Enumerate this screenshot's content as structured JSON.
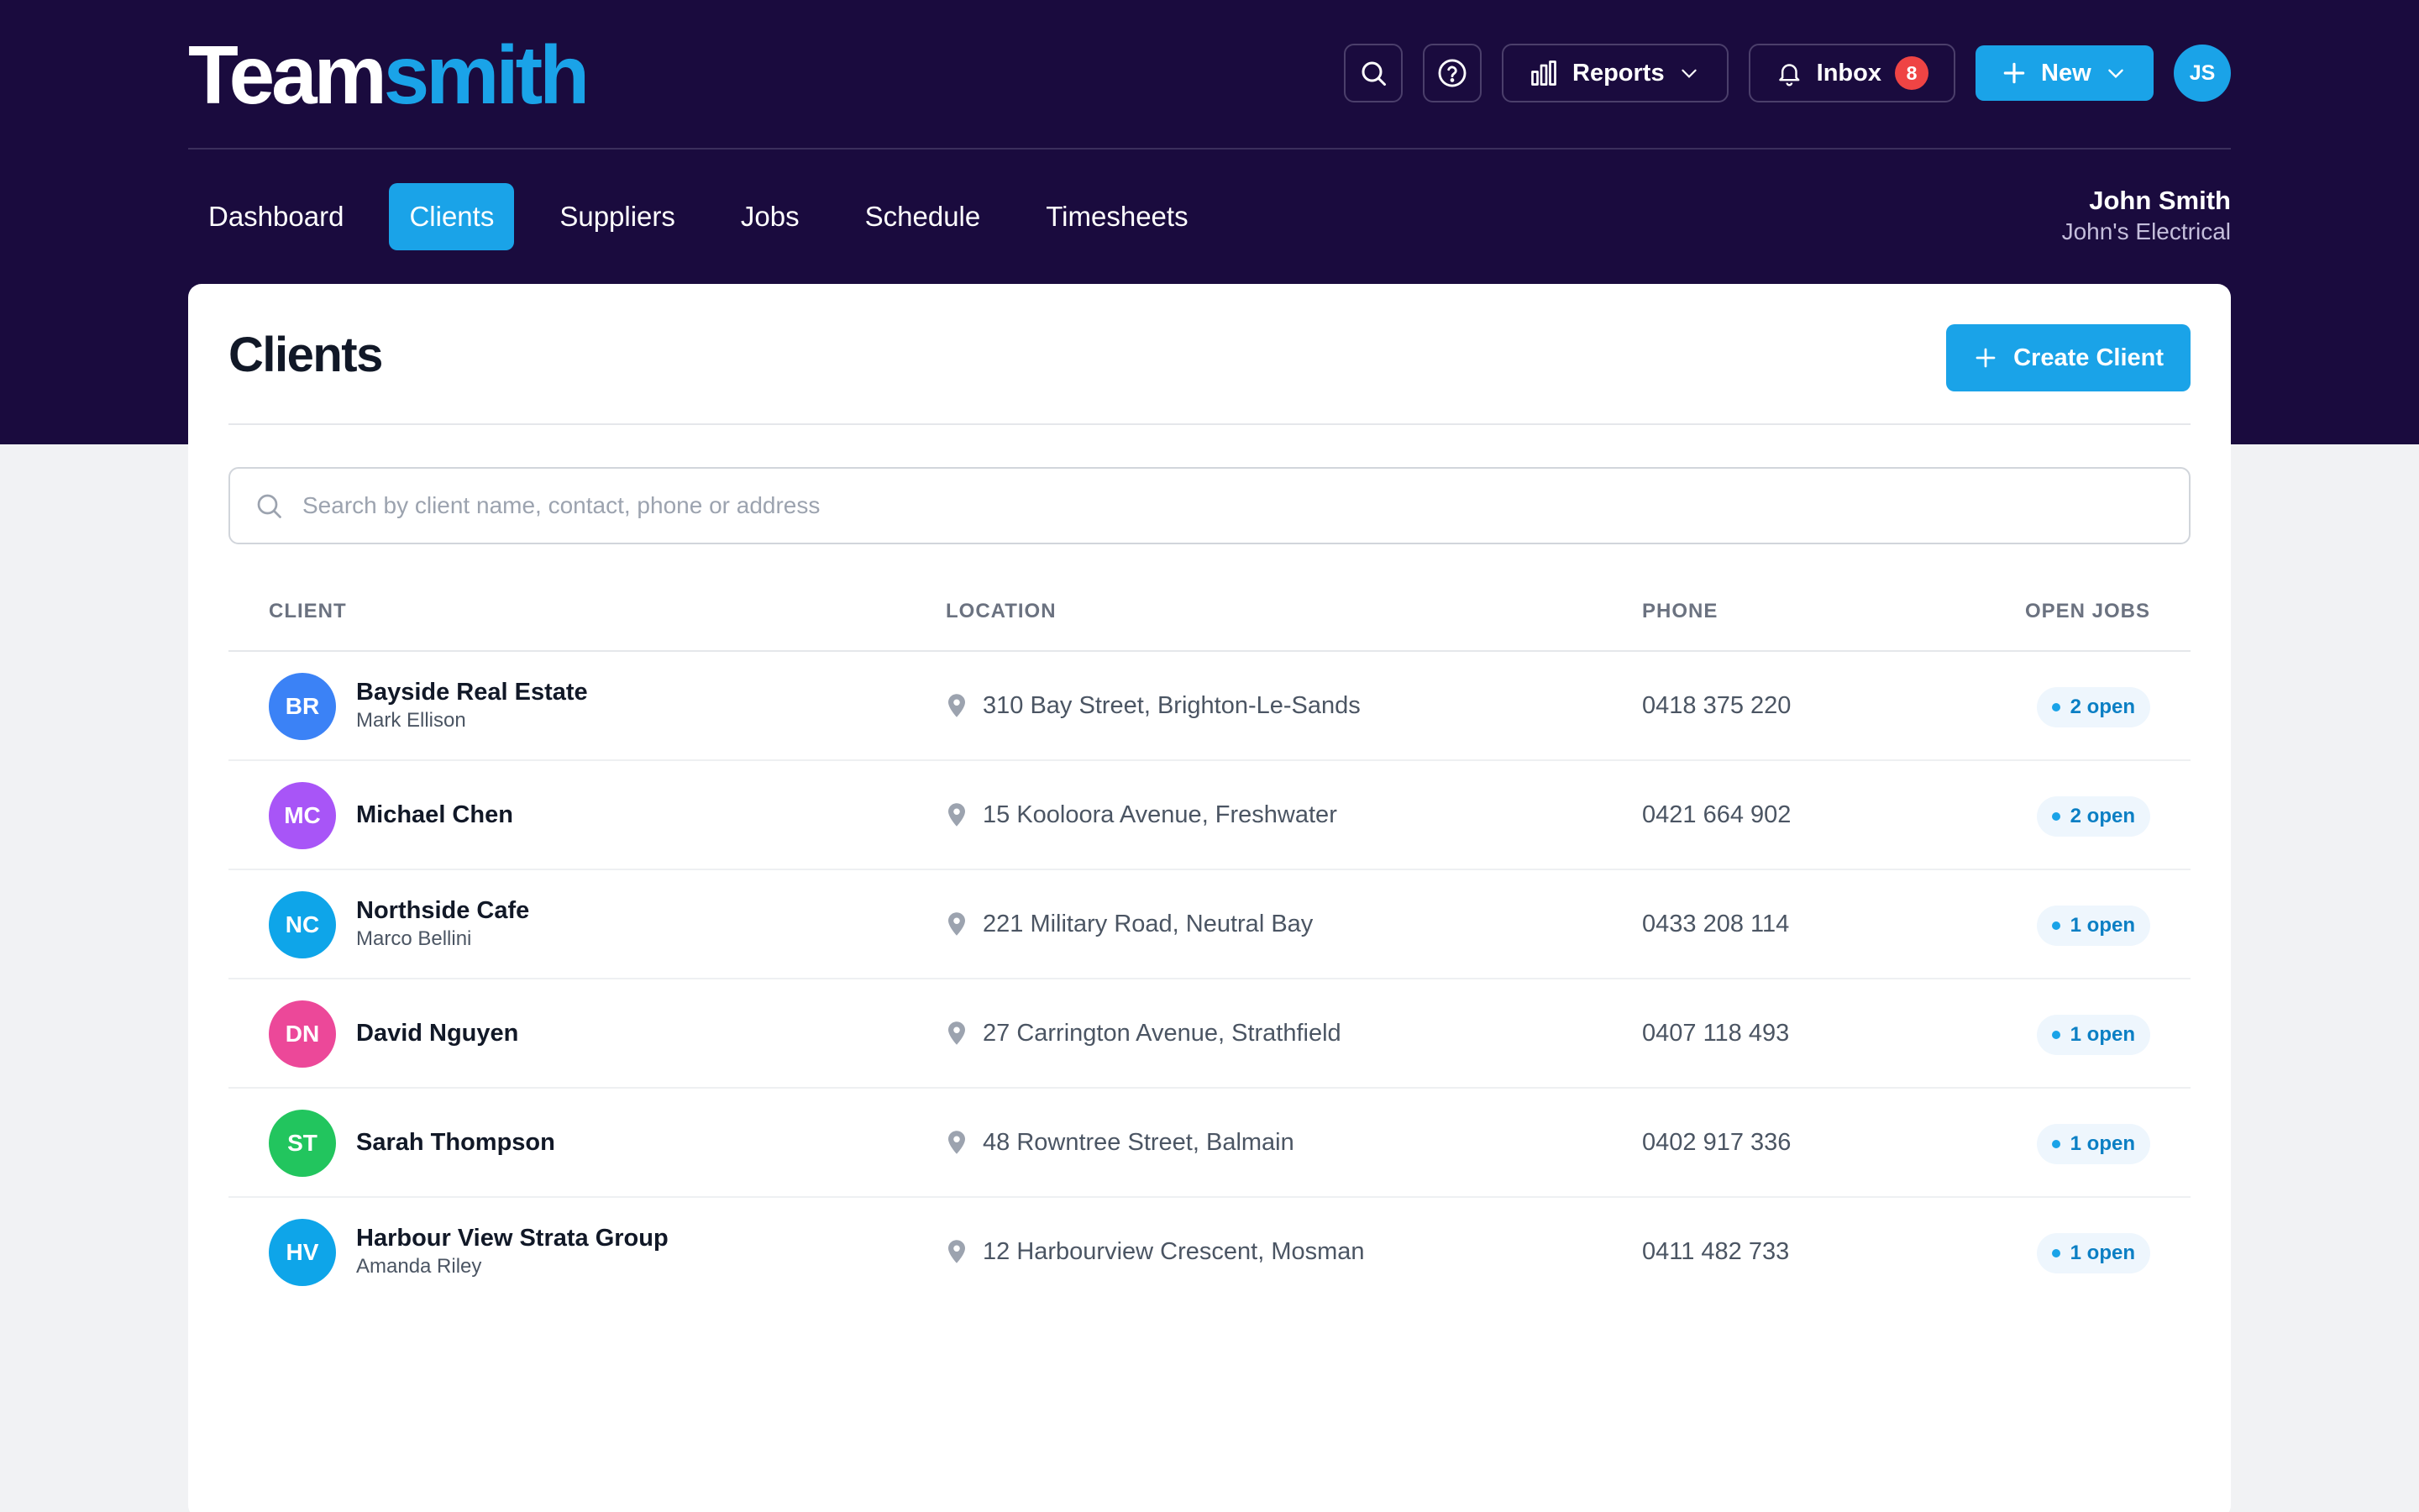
{
  "app": {
    "logo_primary": "Team",
    "logo_accent": "smith"
  },
  "header": {
    "search_icon": "search-icon",
    "help_icon": "help-icon",
    "reports_label": "Reports",
    "inbox_label": "Inbox",
    "inbox_count": "8",
    "new_label": "New",
    "user_initials": "JS"
  },
  "nav": {
    "items": [
      {
        "label": "Dashboard"
      },
      {
        "label": "Clients",
        "active": true
      },
      {
        "label": "Suppliers"
      },
      {
        "label": "Jobs"
      },
      {
        "label": "Schedule"
      },
      {
        "label": "Timesheets"
      }
    ]
  },
  "user": {
    "name": "John Smith",
    "company": "John's Electrical"
  },
  "page": {
    "title": "Clients",
    "create_label": "Create Client",
    "search_placeholder": "Search by client name, contact, phone or address"
  },
  "table": {
    "headers": {
      "client": "CLIENT",
      "location": "LOCATION",
      "phone": "PHONE",
      "open_jobs": "OPEN JOBS"
    },
    "rows": [
      {
        "initials": "BR",
        "color": "#3b82f6",
        "name": "Bayside Real Estate",
        "contact": "Mark Ellison",
        "location": "310 Bay Street, Brighton-Le-Sands",
        "phone": "0418 375 220",
        "open_jobs": "2 open"
      },
      {
        "initials": "MC",
        "color": "#a855f7",
        "name": "Michael Chen",
        "contact": "",
        "location": "15 Kooloora Avenue, Freshwater",
        "phone": "0421 664 902",
        "open_jobs": "2 open"
      },
      {
        "initials": "NC",
        "color": "#0ea5e9",
        "name": "Northside Cafe",
        "contact": "Marco Bellini",
        "location": "221 Military Road, Neutral Bay",
        "phone": "0433 208 114",
        "open_jobs": "1 open"
      },
      {
        "initials": "DN",
        "color": "#ec4899",
        "name": "David Nguyen",
        "contact": "",
        "location": "27 Carrington Avenue, Strathfield",
        "phone": "0407 118 493",
        "open_jobs": "1 open"
      },
      {
        "initials": "ST",
        "color": "#22c55e",
        "name": "Sarah Thompson",
        "contact": "",
        "location": "48 Rowntree Street, Balmain",
        "phone": "0402 917 336",
        "open_jobs": "1 open"
      },
      {
        "initials": "HV",
        "color": "#0ea5e9",
        "name": "Harbour View Strata Group",
        "contact": "Amanda Riley",
        "location": "12 Harbourview Crescent, Mosman",
        "phone": "0411 482 733",
        "open_jobs": "1 open"
      }
    ]
  },
  "colors": {
    "header_bg": "#1a0b3e",
    "accent": "#1aa3e8",
    "badge": "#ef4444"
  }
}
